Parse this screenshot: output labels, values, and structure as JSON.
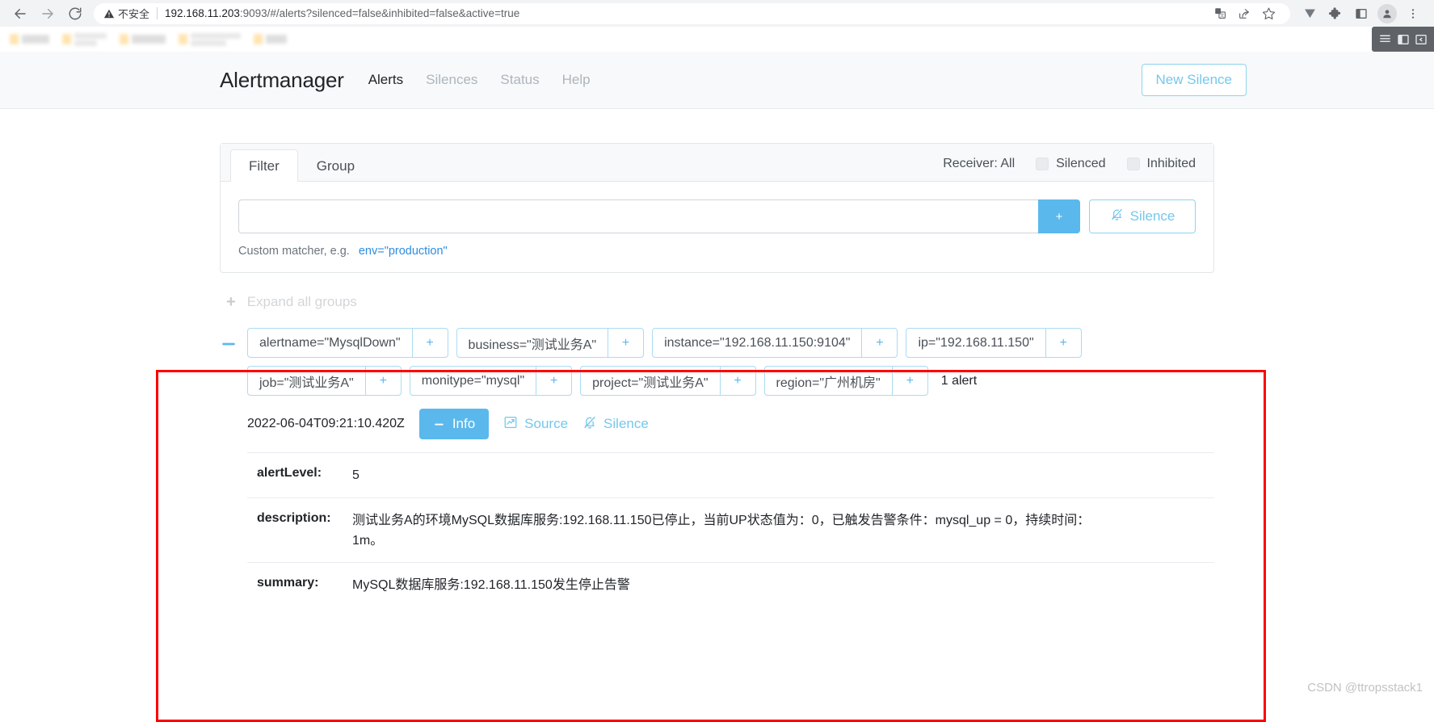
{
  "browser": {
    "back_icon": "back-arrow-icon",
    "forward_icon": "forward-arrow-icon",
    "reload_icon": "reload-icon",
    "security_label": "不安全",
    "url_host": "192.168.11.203",
    "url_rest": ":9093/#/alerts?silenced=false&inhibited=false&active=true",
    "omni_icons": [
      "translate-icon",
      "share-icon",
      "bookmark-star-icon"
    ],
    "toolbar_icons": [
      "v-extension-icon",
      "extensions-puzzle-icon",
      "side-panel-icon",
      "profile-avatar-icon",
      "chrome-menu-icon"
    ],
    "side_panel_icons": [
      "reading-list-icon",
      "bookmarks-panel-icon",
      "collapse-panel-icon"
    ]
  },
  "app": {
    "brand": "Alertmanager",
    "nav": [
      {
        "label": "Alerts",
        "active": true
      },
      {
        "label": "Silences",
        "active": false
      },
      {
        "label": "Status",
        "active": false
      },
      {
        "label": "Help",
        "active": false
      }
    ],
    "new_silence_label": "New Silence"
  },
  "filter": {
    "tabs": [
      {
        "label": "Filter",
        "active": true
      },
      {
        "label": "Group",
        "active": false
      }
    ],
    "receiver_label": "Receiver: All",
    "checkboxes": [
      {
        "label": "Silenced",
        "checked": false
      },
      {
        "label": "Inhibited",
        "checked": false
      }
    ],
    "matcher_value": "",
    "matcher_placeholder": "",
    "add_label": "+",
    "silence_label": "Silence",
    "silence_icon": "bell-slash-icon",
    "hint_text": "Custom matcher, e.g.",
    "hint_code": "env=\"production\""
  },
  "groups": {
    "expand_all_label": "Expand all groups",
    "expand_all_icon": "plus-icon",
    "collapse_icon": "minus-icon",
    "alert_count_label": "1 alert",
    "labels": [
      {
        "text": "alertname=\"MysqlDown\"",
        "add": "+"
      },
      {
        "text": "business=\"测试业务A\"",
        "add": "+"
      },
      {
        "text": "instance=\"192.168.11.150:9104\"",
        "add": "+"
      },
      {
        "text": "ip=\"192.168.11.150\"",
        "add": "+"
      },
      {
        "text": "job=\"测试业务A\"",
        "add": "+"
      },
      {
        "text": "monitype=\"mysql\"",
        "add": "+"
      },
      {
        "text": "project=\"测试业务A\"",
        "add": "+"
      },
      {
        "text": "region=\"广州机房\"",
        "add": "+"
      }
    ]
  },
  "alert": {
    "timestamp": "2022-06-04T09:21:10.420Z",
    "info_label": "Info",
    "info_icon": "minus-icon",
    "source_label": "Source",
    "source_icon": "chart-line-icon",
    "silence_label": "Silence",
    "silence_icon": "bell-slash-icon",
    "annotations": [
      {
        "key": "alertLevel:",
        "value": "5"
      },
      {
        "key": "description:",
        "value": "测试业务A的环境MySQL数据库服务:192.168.11.150已停止，当前UP状态值为：0，已触发告警条件：mysql_up = 0，持续时间：1m。"
      },
      {
        "key": "summary:",
        "value": "MySQL数据库服务:192.168.11.150发生停止告警"
      }
    ]
  },
  "watermark": "CSDN @ttropsstack1",
  "colors": {
    "accent": "#5bb8ec",
    "link": "#74c8ec",
    "highlight_box": "#ff0000",
    "code": "#2e8ce0"
  }
}
